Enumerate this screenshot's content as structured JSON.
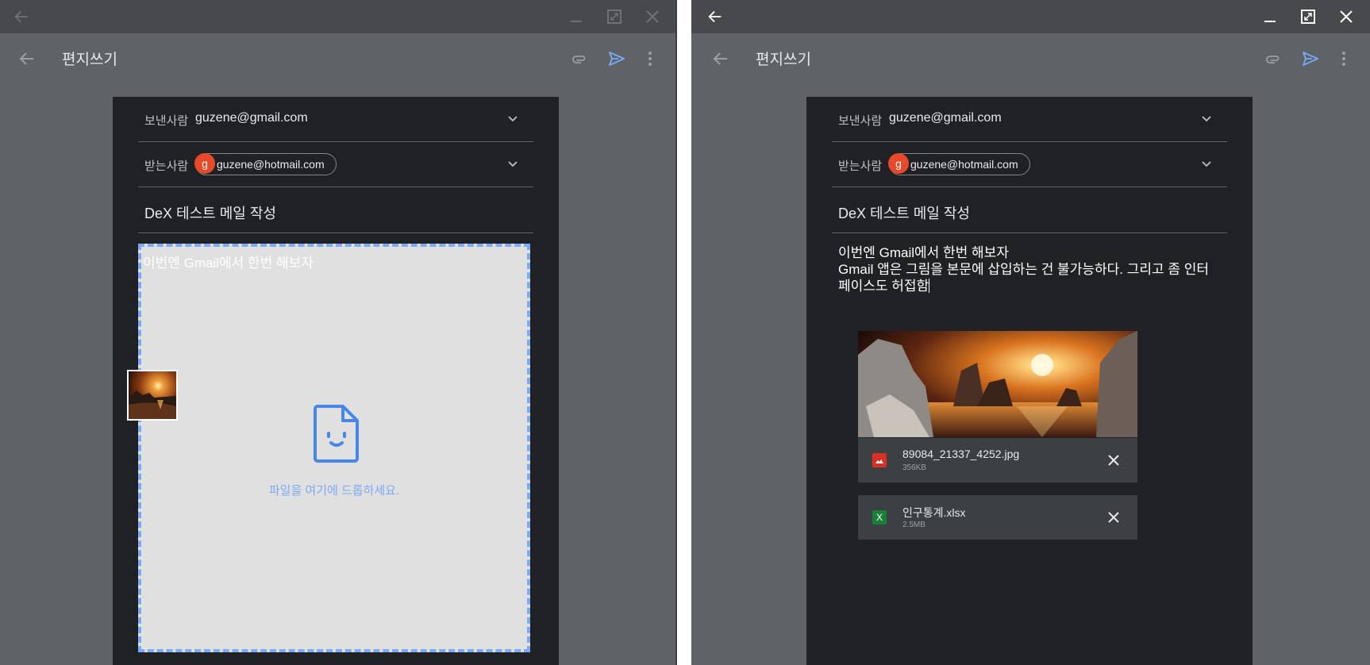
{
  "compose": {
    "title": "편지쓰기",
    "from_label": "보낸사람",
    "from_value": "guzene@gmail.com",
    "to_label": "받는사람",
    "to_chip": "guzene@hotmail.com",
    "to_avatar": "g",
    "subject": "DeX 테스트 메일 작성"
  },
  "left": {
    "body_line": "이번엔 Gmail에서 한번 해보자",
    "drop_hint": "파일을 여기에 드롭하세요."
  },
  "right": {
    "body_lines": [
      "이번엔 Gmail에서 한번 해보자",
      "Gmail 앱은 그림을 본문에 삽입하는 건 불가능하다. 그리고 좀 인터",
      "페이스도 허접함"
    ],
    "attachments": [
      {
        "name": "89084_21337_4252.jpg",
        "size": "356KB",
        "type_icon": "image-file-icon",
        "color": "#d93025"
      },
      {
        "name": "인구통계.xlsx",
        "size": "2.5MB",
        "type_icon": "sheets-file-icon",
        "type_glyph": "X",
        "color": "#188038"
      }
    ]
  },
  "icons": {
    "back": "arrow-left-icon",
    "attach": "paperclip-icon",
    "send": "send-icon",
    "more": "more-vert-icon",
    "dropdown": "chevron-down-icon",
    "minimize": "minimize-icon",
    "maximize": "maximize-icon",
    "close": "close-icon",
    "drop": "smiley-file-icon"
  },
  "colors": {
    "window_bg": "#5f6368",
    "titlebar": "#48494c",
    "sheet": "#202124",
    "accent": "#7baaf7",
    "avatar": "#e8492a"
  }
}
